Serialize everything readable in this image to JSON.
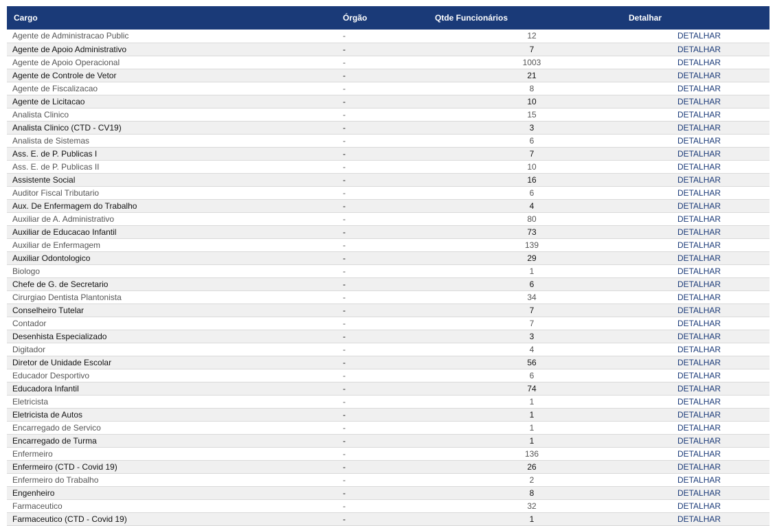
{
  "table": {
    "headers": {
      "cargo": "Cargo",
      "orgao": "Órgão",
      "qtde": "Qtde Funcionários",
      "detalhar": "Detalhar"
    },
    "link_label": "DETALHAR",
    "rows": [
      {
        "cargo": "Agente de Administracao Public",
        "orgao": "-",
        "qtde": "12"
      },
      {
        "cargo": "Agente de Apoio Administrativo",
        "orgao": "-",
        "qtde": "7"
      },
      {
        "cargo": "Agente de Apoio Operacional",
        "orgao": "-",
        "qtde": "1003"
      },
      {
        "cargo": "Agente de Controle de Vetor",
        "orgao": "-",
        "qtde": "21"
      },
      {
        "cargo": "Agente de Fiscalizacao",
        "orgao": "-",
        "qtde": "8"
      },
      {
        "cargo": "Agente de Licitacao",
        "orgao": "-",
        "qtde": "10"
      },
      {
        "cargo": "Analista Clinico",
        "orgao": "-",
        "qtde": "15"
      },
      {
        "cargo": "Analista Clinico (CTD - CV19)",
        "orgao": "-",
        "qtde": "3"
      },
      {
        "cargo": "Analista de Sistemas",
        "orgao": "-",
        "qtde": "6"
      },
      {
        "cargo": "Ass. E. de P. Publicas I",
        "orgao": "-",
        "qtde": "7"
      },
      {
        "cargo": "Ass. E. de P. Publicas II",
        "orgao": "-",
        "qtde": "10"
      },
      {
        "cargo": "Assistente Social",
        "orgao": "-",
        "qtde": "16"
      },
      {
        "cargo": "Auditor Fiscal Tributario",
        "orgao": "-",
        "qtde": "6"
      },
      {
        "cargo": "Aux. De Enfermagem do Trabalho",
        "orgao": "-",
        "qtde": "4"
      },
      {
        "cargo": "Auxiliar de A. Administrativo",
        "orgao": "-",
        "qtde": "80"
      },
      {
        "cargo": "Auxiliar de Educacao Infantil",
        "orgao": "-",
        "qtde": "73"
      },
      {
        "cargo": "Auxiliar de Enfermagem",
        "orgao": "-",
        "qtde": "139"
      },
      {
        "cargo": "Auxiliar Odontologico",
        "orgao": "-",
        "qtde": "29"
      },
      {
        "cargo": "Biologo",
        "orgao": "-",
        "qtde": "1"
      },
      {
        "cargo": "Chefe de G. de Secretario",
        "orgao": "-",
        "qtde": "6"
      },
      {
        "cargo": "Cirurgiao Dentista Plantonista",
        "orgao": "-",
        "qtde": "34"
      },
      {
        "cargo": "Conselheiro Tutelar",
        "orgao": "-",
        "qtde": "7"
      },
      {
        "cargo": "Contador",
        "orgao": "-",
        "qtde": "7"
      },
      {
        "cargo": "Desenhista Especializado",
        "orgao": "-",
        "qtde": "3"
      },
      {
        "cargo": "Digitador",
        "orgao": "-",
        "qtde": "4"
      },
      {
        "cargo": "Diretor de Unidade Escolar",
        "orgao": "-",
        "qtde": "56"
      },
      {
        "cargo": "Educador Desportivo",
        "orgao": "-",
        "qtde": "6"
      },
      {
        "cargo": "Educadora Infantil",
        "orgao": "-",
        "qtde": "74"
      },
      {
        "cargo": "Eletricista",
        "orgao": "-",
        "qtde": "1"
      },
      {
        "cargo": "Eletricista de Autos",
        "orgao": "-",
        "qtde": "1"
      },
      {
        "cargo": "Encarregado de Servico",
        "orgao": "-",
        "qtde": "1"
      },
      {
        "cargo": "Encarregado de Turma",
        "orgao": "-",
        "qtde": "1"
      },
      {
        "cargo": "Enfermeiro",
        "orgao": "-",
        "qtde": "136"
      },
      {
        "cargo": "Enfermeiro (CTD - Covid 19)",
        "orgao": "-",
        "qtde": "26"
      },
      {
        "cargo": "Enfermeiro do Trabalho",
        "orgao": "-",
        "qtde": "2"
      },
      {
        "cargo": "Engenheiro",
        "orgao": "-",
        "qtde": "8"
      },
      {
        "cargo": "Farmaceutico",
        "orgao": "-",
        "qtde": "32"
      },
      {
        "cargo": "Farmaceutico (CTD - Covid 19)",
        "orgao": "-",
        "qtde": "1"
      }
    ]
  },
  "colors": {
    "header_bg": "#1a3a78",
    "header_text": "#ffffff",
    "link": "#1a3a78",
    "row_alt_bg": "#f0f0f0"
  }
}
